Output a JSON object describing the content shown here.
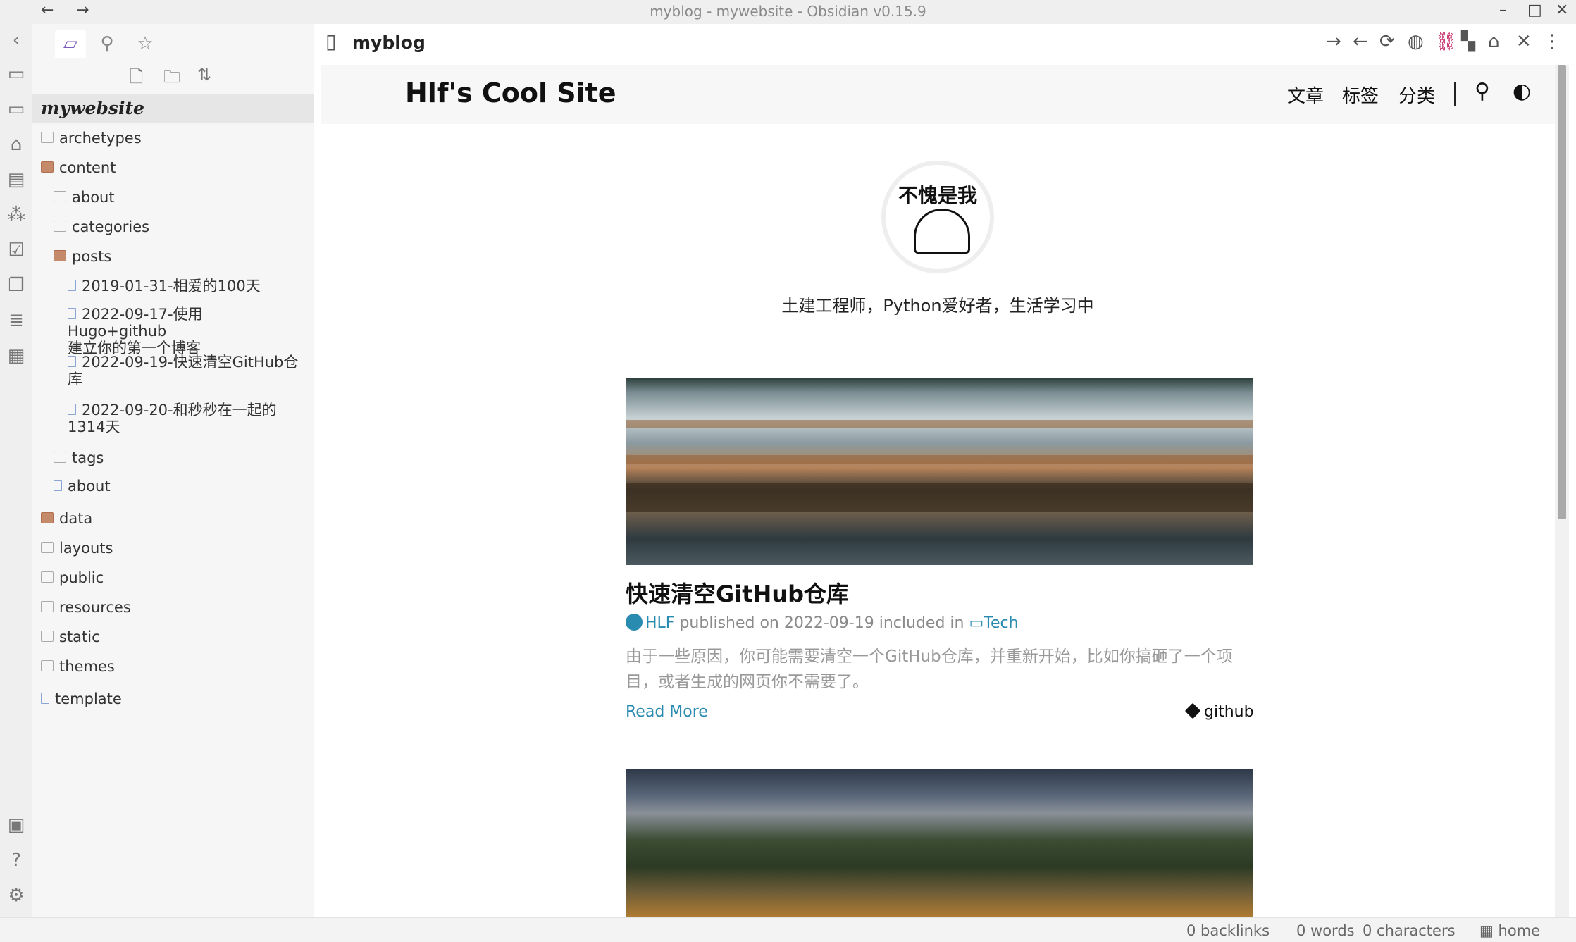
{
  "window": {
    "title": "myblog - mywebsite - Obsidian v0.15.9",
    "back_icon": "arrow-left-icon",
    "forward_icon": "arrow-right-icon",
    "minimize": "–",
    "maximize": "□",
    "close": "✕"
  },
  "ribbon": {
    "items": [
      "collapse-chevron-icon",
      "open-note-icon",
      "open-note-icon",
      "home-icon",
      "template-icon",
      "graph-icon",
      "calendar-icon",
      "copy-icon",
      "cards-icon",
      "table-icon",
      "vault-icon",
      "help-icon",
      "settings-icon"
    ]
  },
  "sidebar": {
    "tabs": [
      "file-explorer-icon",
      "search-icon",
      "bookmark-star-icon"
    ],
    "actions": [
      "new-note-icon",
      "new-folder-icon",
      "sort-icon"
    ],
    "vault_name": "mywebsite",
    "tree": {
      "archetypes": "archetypes",
      "content": "content",
      "about_folder": "about",
      "categories": "categories",
      "posts": "posts",
      "post1": "2019-01-31-相爱的100天",
      "post2_line1": "2022-09-17-使用Hugo+github",
      "post2_line2": "建立你的第一个博客",
      "post3_line1": "2022-09-19-快速清空GitHub仓",
      "post3_line2": "库",
      "post4_line1": "2022-09-20-和秒秒在一起的",
      "post4_line2": "1314天",
      "tags": "tags",
      "about_file": "about",
      "data": "data",
      "layouts": "layouts",
      "public": "public",
      "resources": "resources",
      "static": "static",
      "themes": "themes",
      "template": "template"
    }
  },
  "pane": {
    "title": "myblog",
    "actions": [
      "forward-icon",
      "back-icon",
      "reload-icon",
      "globe-icon",
      "link-icon",
      "qr-icon",
      "home-icon",
      "close-icon",
      "more-icon"
    ]
  },
  "site": {
    "title": "Hlf's Cool Site",
    "nav": [
      "文章",
      "标签",
      "分类"
    ],
    "avatar_text": "不愧是我",
    "tagline": "土建工程师，Python爱好者，生活学习中",
    "post": {
      "title": "快速清空GitHub仓库",
      "author": "HLF",
      "published_prefix": "published on",
      "date": "2022-09-19",
      "included_in": "included in",
      "category": "Tech",
      "summary": "由于一些原因，你可能需要清空一个GitHub仓库，并重新开始，比如你搞砸了一个项目，或者生成的网页你不需要了。",
      "read_more": "Read More",
      "tag": "github"
    }
  },
  "status": {
    "backlinks": "0 backlinks",
    "words": "0 words",
    "characters": "0 characters",
    "home": "home"
  },
  "colors": {
    "accent": "#7c5cbf",
    "link": "#2a8bb0",
    "folder_open": "#c58a6a"
  }
}
